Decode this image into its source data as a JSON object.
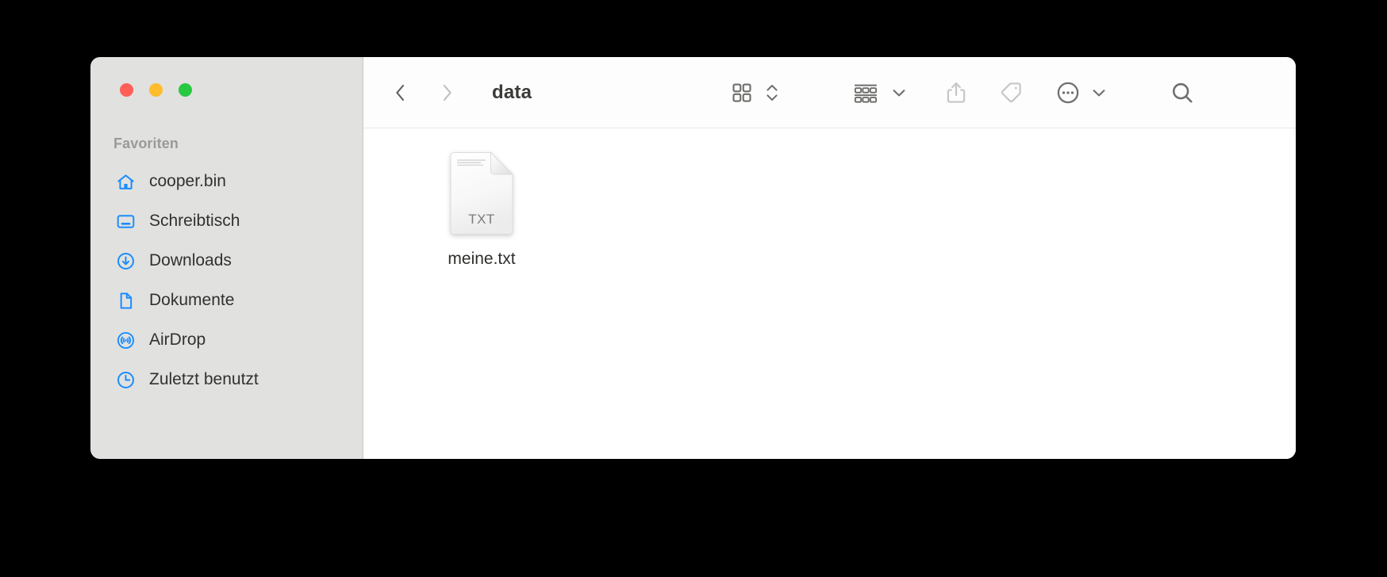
{
  "window": {
    "title": "data",
    "traffic_lights": [
      {
        "name": "close",
        "color": "#ff5f57"
      },
      {
        "name": "minimize",
        "color": "#febc2e"
      },
      {
        "name": "zoom",
        "color": "#28c840"
      }
    ]
  },
  "sidebar": {
    "section_title": "Favoriten",
    "items": [
      {
        "label": "cooper.bin",
        "icon": "home-icon"
      },
      {
        "label": "Schreibtisch",
        "icon": "desktop-icon"
      },
      {
        "label": "Downloads",
        "icon": "download-icon"
      },
      {
        "label": "Dokumente",
        "icon": "document-icon"
      },
      {
        "label": "AirDrop",
        "icon": "airdrop-icon"
      },
      {
        "label": "Zuletzt benutzt",
        "icon": "clock-icon"
      }
    ],
    "accent_color": "#1a8cff",
    "background_color": "#e1e1df"
  },
  "toolbar": {
    "back_label": "Back",
    "forward_label": "Forward",
    "folder_title": "data",
    "icon_view_label": "Icon view",
    "view_stepper_label": "Change view",
    "group_label": "Group items",
    "group_chevron_label": "Group options",
    "share_label": "Share",
    "tag_label": "Tags",
    "more_label": "More actions",
    "more_chevron_label": "More options",
    "search_label": "Search"
  },
  "content": {
    "files": [
      {
        "name": "meine.txt",
        "kind": "TXT",
        "badge": "TXT"
      }
    ]
  }
}
